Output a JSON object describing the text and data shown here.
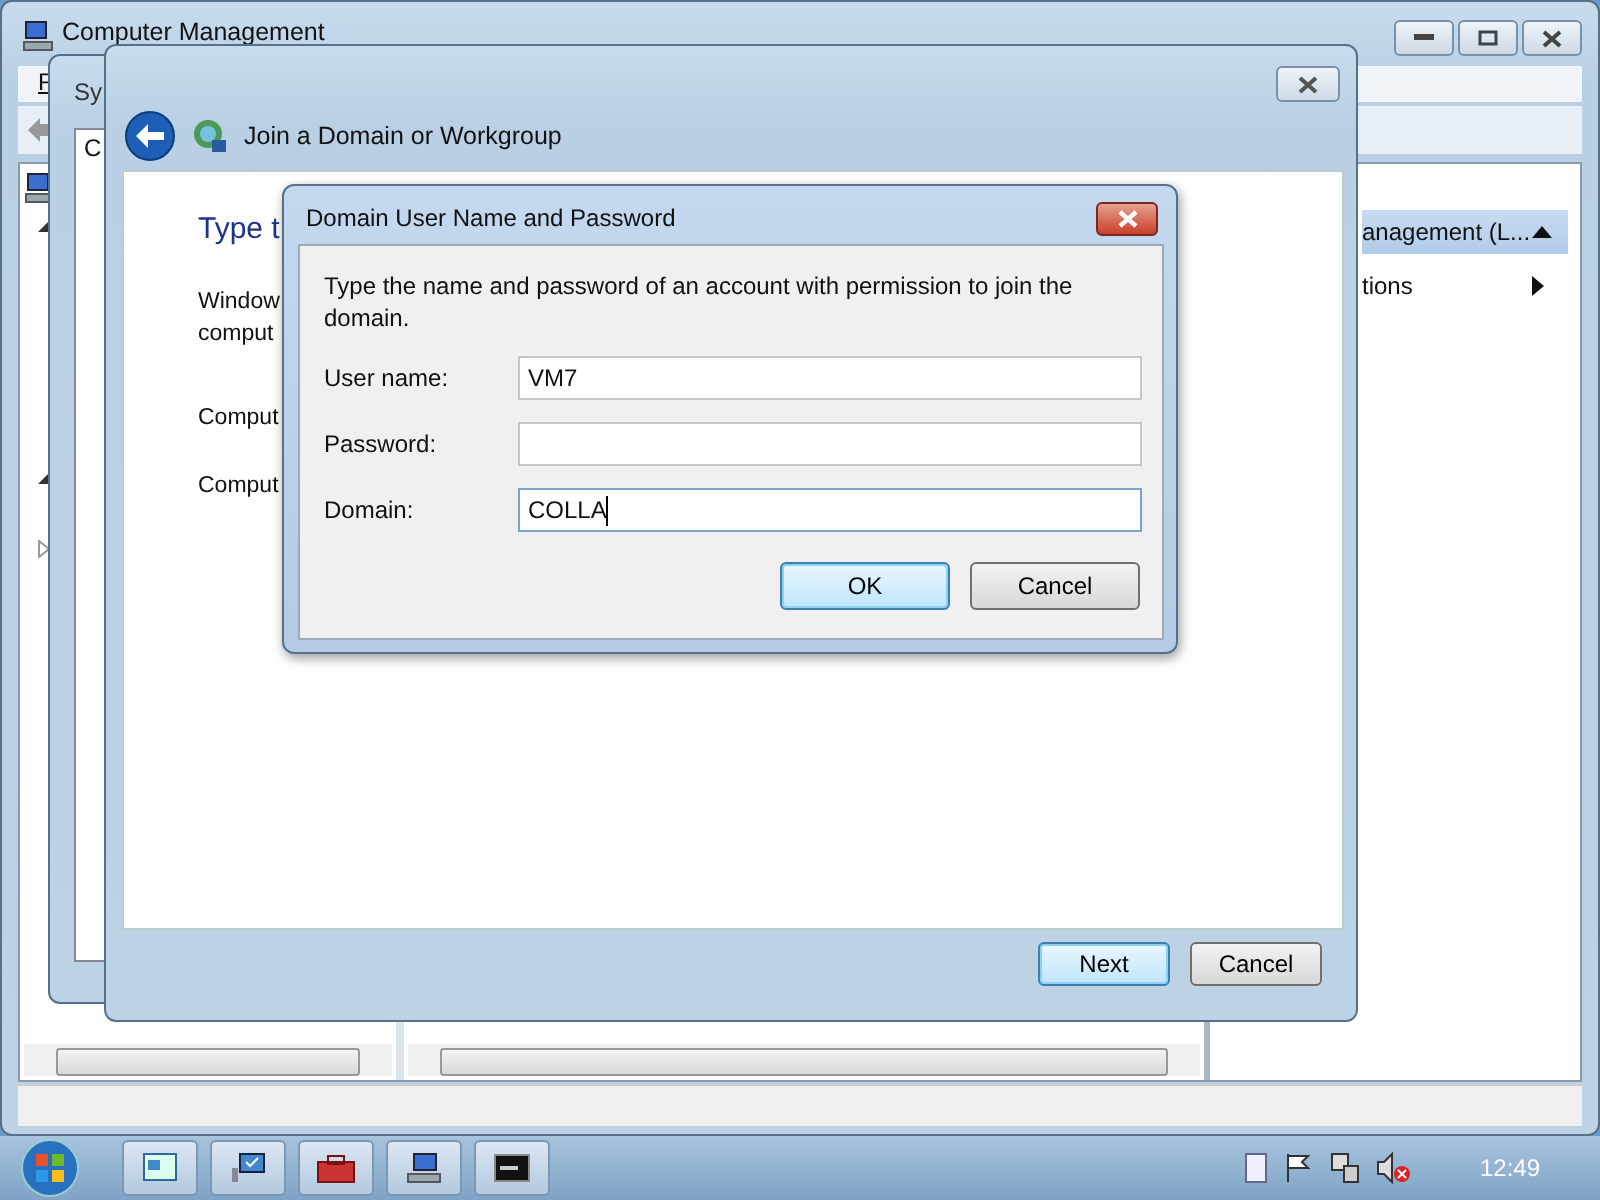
{
  "main_window": {
    "title": "Computer Management",
    "menu": [
      "F"
    ],
    "right_pane": {
      "header": "anagement (L...",
      "items": [
        "tions"
      ]
    }
  },
  "system_window": {
    "title": "Sy",
    "tab": "C"
  },
  "wizard": {
    "title": "Join a Domain or Workgroup",
    "heading": "Type t",
    "lines": [
      "Window",
      "comput"
    ],
    "labels": [
      "Comput",
      "Comput"
    ],
    "buttons": [
      {
        "label": "Next",
        "default": true
      },
      {
        "label": "Cancel",
        "default": false
      }
    ]
  },
  "dialog": {
    "title": "Domain User Name and Password",
    "prompt": "Type the name and password of an account with permission to join the domain.",
    "fields": [
      {
        "label": "User name:",
        "value": "VM7",
        "focused": false
      },
      {
        "label": "Password:",
        "focused": false
      },
      {
        "label": "Domain:",
        "value": "COLLA",
        "focused": true
      }
    ],
    "buttons": [
      {
        "label": "OK",
        "default": true
      },
      {
        "label": "Cancel",
        "default": false
      }
    ]
  },
  "taskbar": {
    "clock": "12:49"
  }
}
